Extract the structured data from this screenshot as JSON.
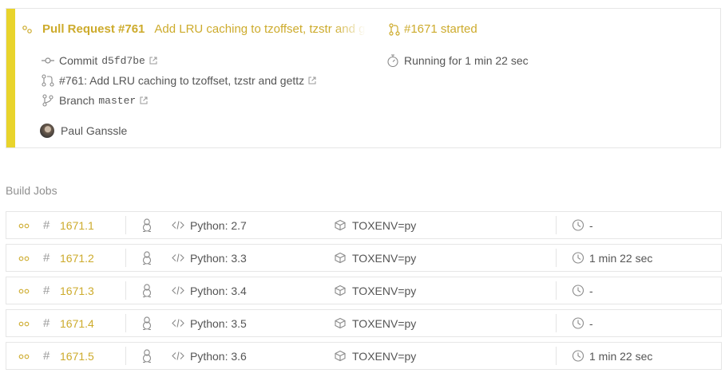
{
  "build": {
    "pr_label": "Pull Request #761",
    "pr_message": "Add LRU caching to tzoffset, tzstr and gettz",
    "started": "#1671 started",
    "commit_label": "Commit",
    "commit_hash": "d5fd7be",
    "pr_link": "#761: Add LRU caching to tzoffset, tzstr and gettz",
    "branch_label": "Branch",
    "branch_name": "master",
    "running": "Running for 1 min 22 sec",
    "author": "Paul Ganssle",
    "accent_color": "#e9d42b",
    "link_color": "#cdab2c"
  },
  "section_title": "Build Jobs",
  "jobs": [
    {
      "number": "1671.1",
      "language": "Python: 2.7",
      "env": "TOXENV=py",
      "duration": "-"
    },
    {
      "number": "1671.2",
      "language": "Python: 3.3",
      "env": "TOXENV=py",
      "duration": "1 min 22 sec"
    },
    {
      "number": "1671.3",
      "language": "Python: 3.4",
      "env": "TOXENV=py",
      "duration": "-"
    },
    {
      "number": "1671.4",
      "language": "Python: 3.5",
      "env": "TOXENV=py",
      "duration": "-"
    },
    {
      "number": "1671.5",
      "language": "Python: 3.6",
      "env": "TOXENV=py",
      "duration": "1 min 22 sec"
    }
  ],
  "icons": {
    "status": "running-dots-icon",
    "os": "linux-tux-icon",
    "language": "code-icon",
    "env": "package-box-icon",
    "duration": "clock-icon"
  }
}
